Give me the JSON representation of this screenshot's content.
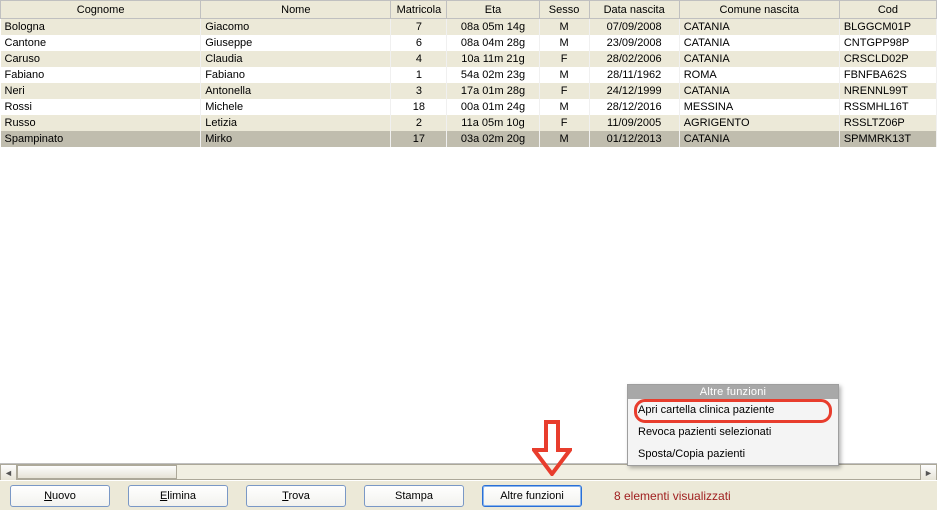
{
  "columns": {
    "cognome": "Cognome",
    "nome": "Nome",
    "matricola": "Matricola",
    "eta": "Eta",
    "sesso": "Sesso",
    "data_nascita": "Data nascita",
    "comune_nascita": "Comune nascita",
    "cod": "Cod"
  },
  "rows": [
    {
      "cognome": "Bologna",
      "nome": "Giacomo",
      "matricola": "7",
      "eta": "08a 05m 14g",
      "sesso": "M",
      "data_nascita": "07/09/2008",
      "comune": "CATANIA",
      "cod": "BLGGCM01P"
    },
    {
      "cognome": "Cantone",
      "nome": "Giuseppe",
      "matricola": "6",
      "eta": "08a 04m 28g",
      "sesso": "M",
      "data_nascita": "23/09/2008",
      "comune": "CATANIA",
      "cod": "CNTGPP98P"
    },
    {
      "cognome": "Caruso",
      "nome": "Claudia",
      "matricola": "4",
      "eta": "10a 11m 21g",
      "sesso": "F",
      "data_nascita": "28/02/2006",
      "comune": "CATANIA",
      "cod": "CRSCLD02P"
    },
    {
      "cognome": "Fabiano",
      "nome": "Fabiano",
      "matricola": "1",
      "eta": "54a 02m 23g",
      "sesso": "M",
      "data_nascita": "28/11/1962",
      "comune": "ROMA",
      "cod": "FBNFBA62S"
    },
    {
      "cognome": "Neri",
      "nome": "Antonella",
      "matricola": "3",
      "eta": "17a 01m 28g",
      "sesso": "F",
      "data_nascita": "24/12/1999",
      "comune": "CATANIA",
      "cod": "NRENNL99T"
    },
    {
      "cognome": "Rossi",
      "nome": "Michele",
      "matricola": "18",
      "eta": "00a 01m 24g",
      "sesso": "M",
      "data_nascita": "28/12/2016",
      "comune": "MESSINA",
      "cod": "RSSMHL16T"
    },
    {
      "cognome": "Russo",
      "nome": "Letizia",
      "matricola": "2",
      "eta": "11a 05m 10g",
      "sesso": "F",
      "data_nascita": "11/09/2005",
      "comune": "AGRIGENTO",
      "cod": "RSSLTZ06P"
    },
    {
      "cognome": "Spampinato",
      "nome": "Mirko",
      "matricola": "17",
      "eta": "03a 02m 20g",
      "sesso": "M",
      "data_nascita": "01/12/2013",
      "comune": "CATANIA",
      "cod": "SPMMRK13T"
    }
  ],
  "toolbar": {
    "nuovo": "Nuovo",
    "elimina": "Elimina",
    "trova": "Trova",
    "stampa": "Stampa",
    "altre": "Altre funzioni"
  },
  "status": "8 elementi visualizzati",
  "popup": {
    "title": "Altre funzioni",
    "items": [
      "Apri cartella clinica paziente",
      "Revoca pazienti selezionati",
      "Sposta/Copia pazienti"
    ]
  }
}
